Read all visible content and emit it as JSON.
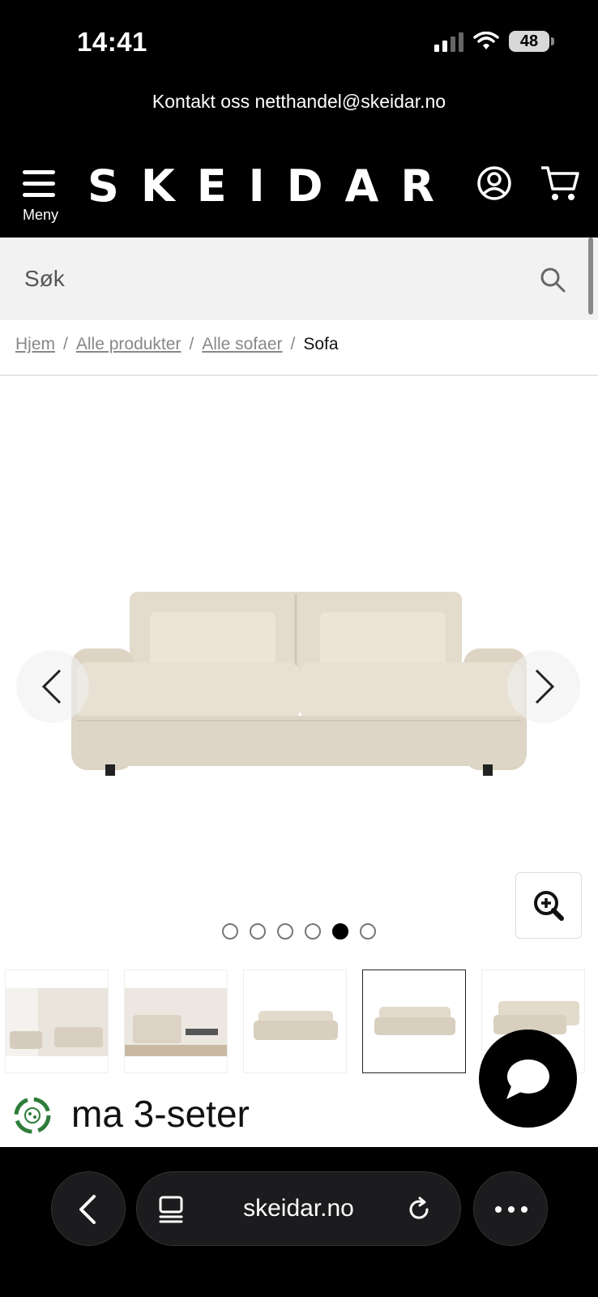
{
  "status_bar": {
    "time": "14:41",
    "battery": "48"
  },
  "promo": {
    "text": "Kontakt oss netthandel@skeidar.no"
  },
  "header": {
    "menu_label": "Meny",
    "logo": "SKEIDAR"
  },
  "search": {
    "placeholder": "Søk"
  },
  "breadcrumb": {
    "items": [
      "Hjem",
      "Alle produkter",
      "Alle sofaer"
    ],
    "separator": "/",
    "current": "Sofa"
  },
  "gallery": {
    "image_count": 6,
    "active_index": 4
  },
  "product": {
    "title_partial": "ma 3-seter"
  },
  "browser": {
    "url": "skeidar.no"
  },
  "colors": {
    "header_bg": "#000000",
    "search_bg": "#f2f2f2",
    "sofa": "#e6ded0"
  }
}
